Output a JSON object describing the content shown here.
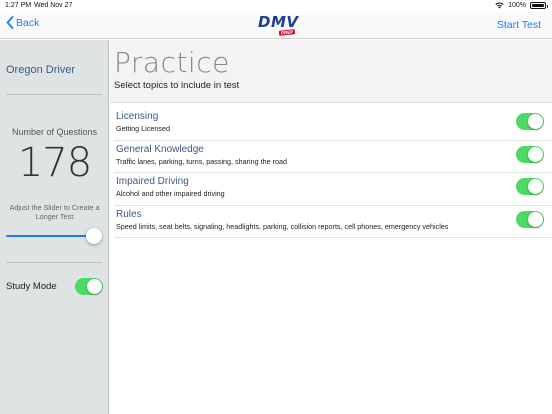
{
  "status_bar": {
    "time": "1:27 PM",
    "date": "Wed Nov 27",
    "battery": "100%"
  },
  "nav": {
    "back_label": "Back",
    "logo_text": "DMV",
    "logo_badge": "PREP",
    "start_label": "Start Test"
  },
  "sidebar": {
    "title": "Oregon Driver",
    "questions_label": "Number of Questions",
    "question_count": "178",
    "slider_hint": "Adjust the Slider to Create a Longer Test",
    "slider_level": 0.9,
    "study_mode_label": "Study Mode",
    "study_mode_on": true
  },
  "main": {
    "title": "Practice",
    "subtitle": "Select topics to include in test",
    "topics": [
      {
        "title": "Licensing",
        "desc": "Getting Licensed",
        "on": true
      },
      {
        "title": "General Knowledge",
        "desc": "Traffic lanes, parking, turns, passing, sharing the road",
        "on": true
      },
      {
        "title": "Impaired Driving",
        "desc": "Alcohol and other impaired driving",
        "on": true
      },
      {
        "title": "Rules",
        "desc": "Speed limits, seat belts, signaling, headlights, parking, collision reports, cell phones, emergency vehicles",
        "on": true
      }
    ]
  },
  "colors": {
    "accent": "#1a7cf5",
    "toggle_on": "#4cd964",
    "label_blue": "#3a5a85",
    "logo_blue": "#1b3f95",
    "logo_red": "#c8102e"
  },
  "icons": {
    "back": "chevron-left-icon",
    "wifi": "wifi-icon",
    "battery": "battery-icon"
  }
}
